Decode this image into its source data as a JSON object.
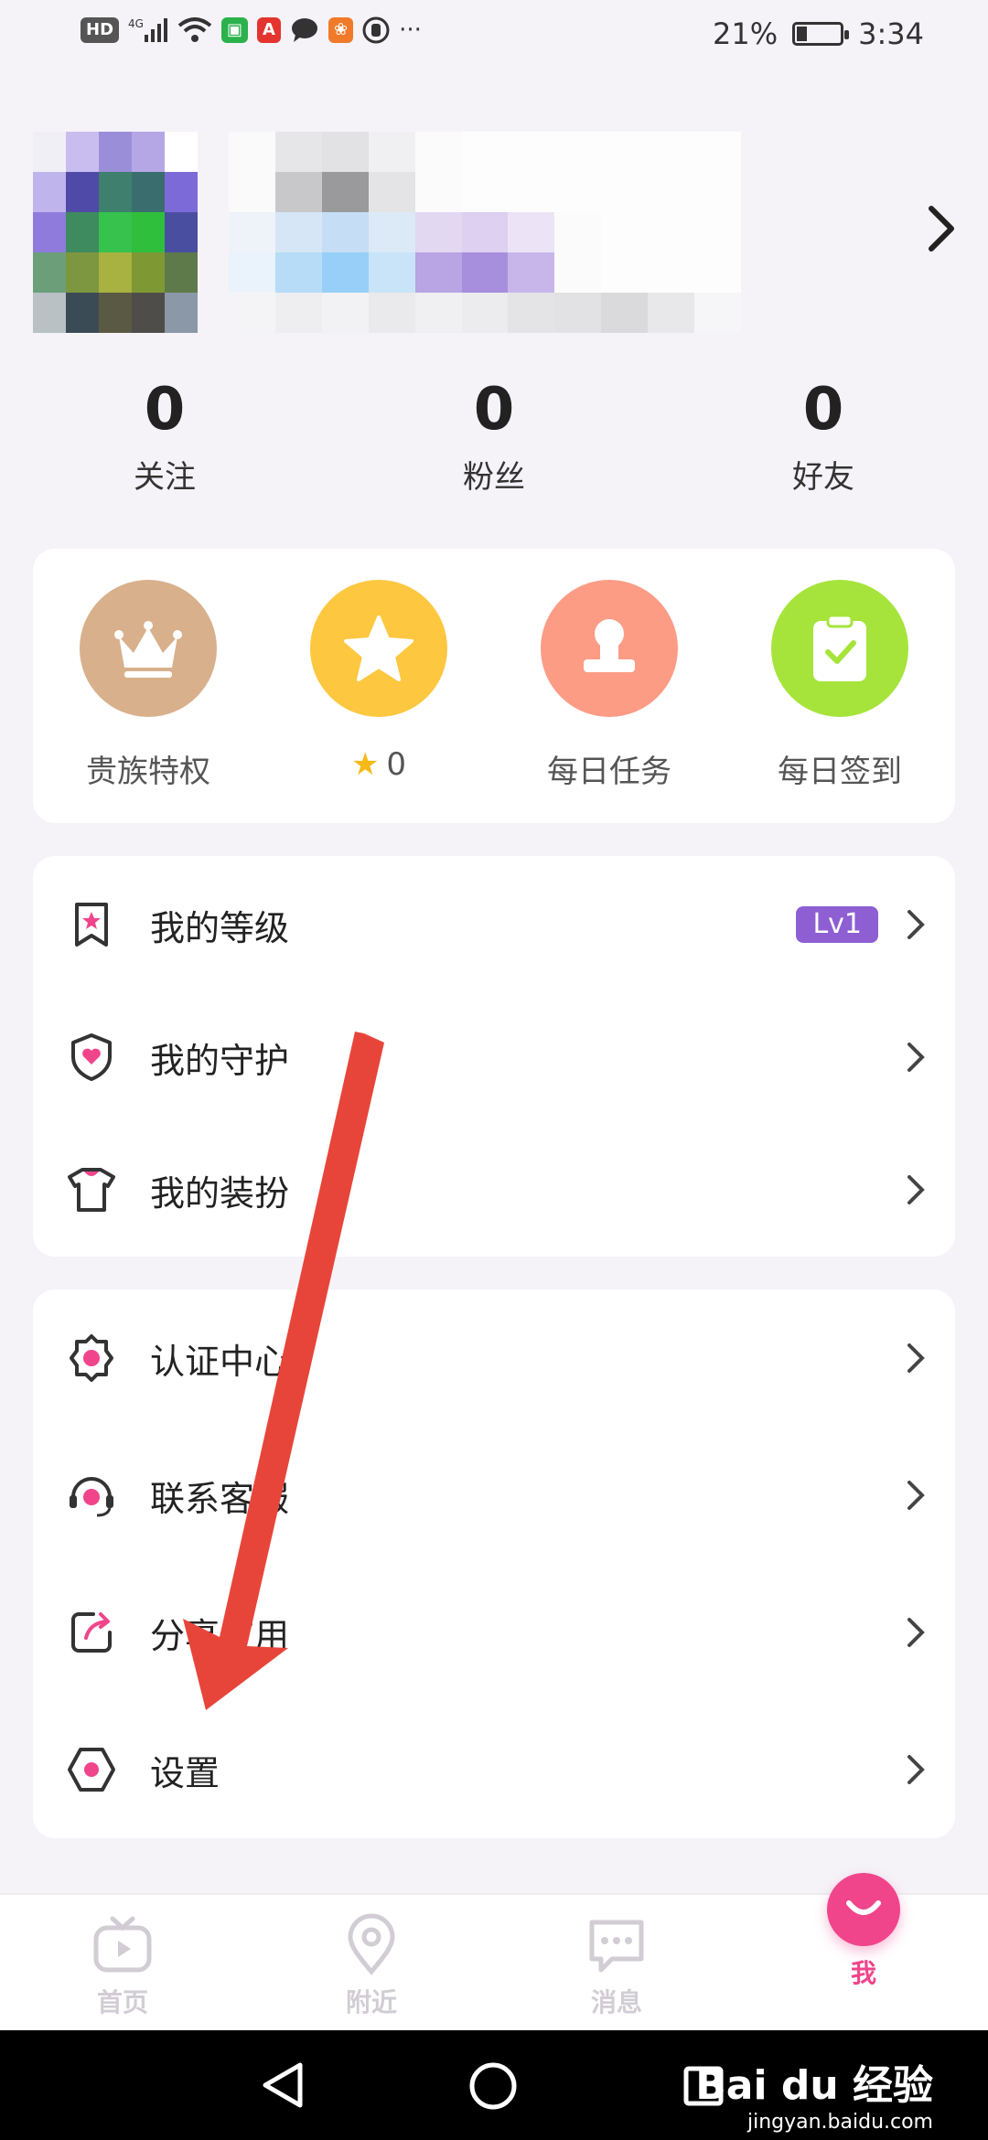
{
  "status_bar": {
    "left_icons": [
      "hd-icon",
      "signal-4g-icon",
      "wifi-icon",
      "app-icon-green",
      "app-icon-red",
      "chat-icon",
      "app-icon-orange",
      "hand-icon"
    ],
    "more": "···",
    "battery_percent": "21%",
    "battery_level": 0.21,
    "time": "3:34"
  },
  "stats": [
    {
      "count": "0",
      "label": "关注"
    },
    {
      "count": "0",
      "label": "粉丝"
    },
    {
      "count": "0",
      "label": "好友"
    }
  ],
  "quick_actions": [
    {
      "label": "贵族特权",
      "icon": "crown-icon",
      "color": "#d9b08c"
    },
    {
      "label": "0",
      "icon": "star-icon",
      "color": "#fdc740"
    },
    {
      "label": "每日任务",
      "icon": "stamp-icon",
      "color": "#fc9c85"
    },
    {
      "label": "每日签到",
      "icon": "clipboard-check-icon",
      "color": "#a6e43b"
    }
  ],
  "menu_group_1": [
    {
      "label": "我的等级",
      "icon": "bookmark-star-icon",
      "badge": "Lv1"
    },
    {
      "label": "我的守护",
      "icon": "shield-heart-icon"
    },
    {
      "label": "我的装扮",
      "icon": "shirt-icon"
    }
  ],
  "menu_group_2": [
    {
      "label": "认证中心",
      "icon": "badge-gear-icon"
    },
    {
      "label": "联系客服",
      "icon": "headset-icon"
    },
    {
      "label": "分享应用",
      "icon": "share-icon"
    },
    {
      "label": "设置",
      "icon": "hexagon-settings-icon"
    }
  ],
  "bottom_nav": [
    {
      "label": "首页",
      "icon": "tv-icon",
      "active": false
    },
    {
      "label": "附近",
      "icon": "location-pin-icon",
      "active": false
    },
    {
      "label": "消息",
      "icon": "chat-bubble-icon",
      "active": false
    },
    {
      "label": "我",
      "icon": "smile-icon",
      "active": true
    }
  ],
  "colors": {
    "accent": "#f0458b",
    "level_badge": "#8d5fd3",
    "annotation_arrow": "#e8453a"
  },
  "watermark": {
    "brand": "Bai du 经验",
    "url": "jingyan.baidu.com"
  }
}
